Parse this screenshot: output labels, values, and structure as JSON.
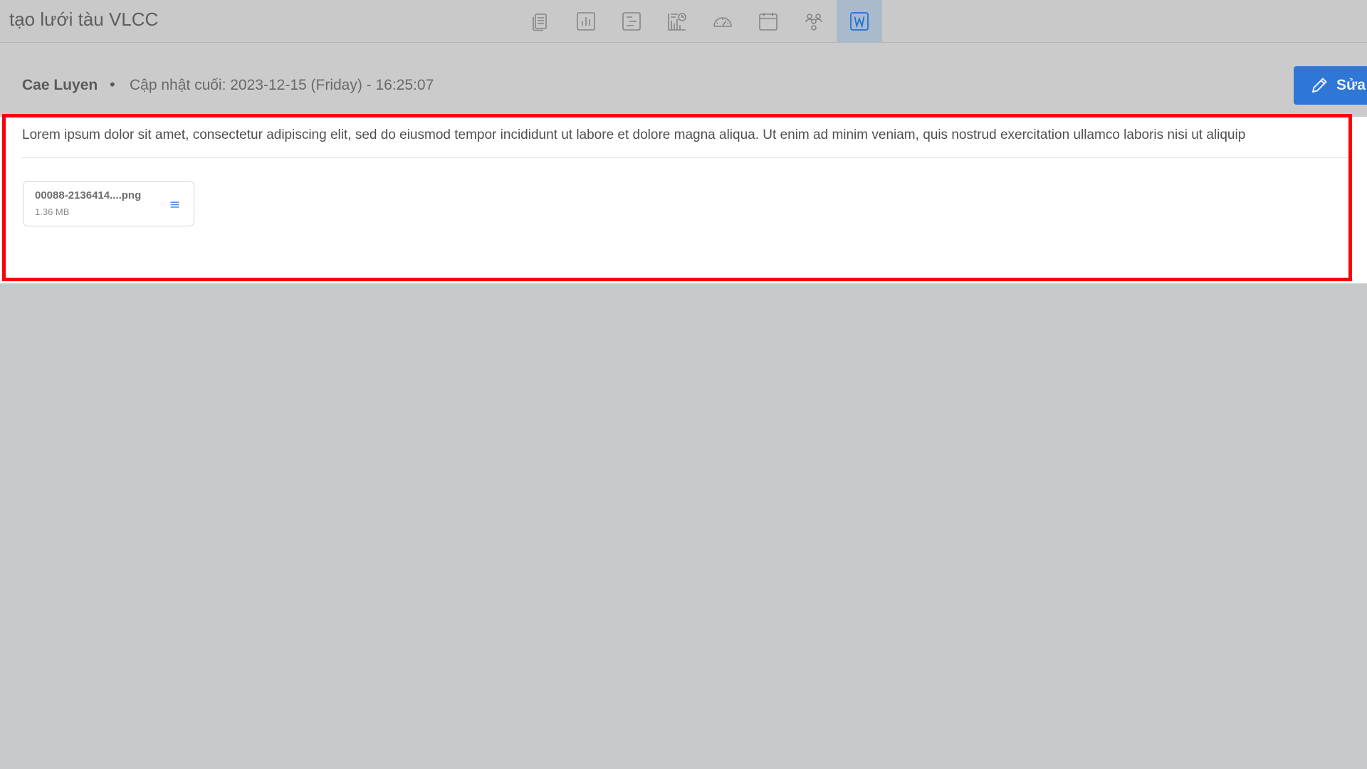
{
  "header": {
    "title": "tạo lưới tàu VLCC",
    "toolbar": [
      {
        "icon": "documents-icon"
      },
      {
        "icon": "bar-chart-icon"
      },
      {
        "icon": "gantt-icon"
      },
      {
        "icon": "chart-report-icon"
      },
      {
        "icon": "speedometer-icon"
      },
      {
        "icon": "calendar-icon"
      },
      {
        "icon": "team-icon"
      },
      {
        "icon": "word-document-icon",
        "active": true
      }
    ]
  },
  "meta": {
    "author": "Cae Luyen",
    "separator": "•",
    "updated": "Cập nhật cuối: 2023-12-15 (Friday) - 16:25:07",
    "edit_label": "Sửa"
  },
  "content": {
    "text": "Lorem ipsum dolor sit amet, consectetur adipiscing elit, sed do eiusmod tempor incididunt ut labore et dolore magna aliqua. Ut enim ad minim veniam, quis nostrud exercitation ullamco laboris nisi ut aliquip",
    "attachment": {
      "name": "00088-2136414....png",
      "size": "1.36 MB"
    }
  },
  "colors": {
    "accent": "#2f77d6",
    "highlight": "#fb0007"
  }
}
